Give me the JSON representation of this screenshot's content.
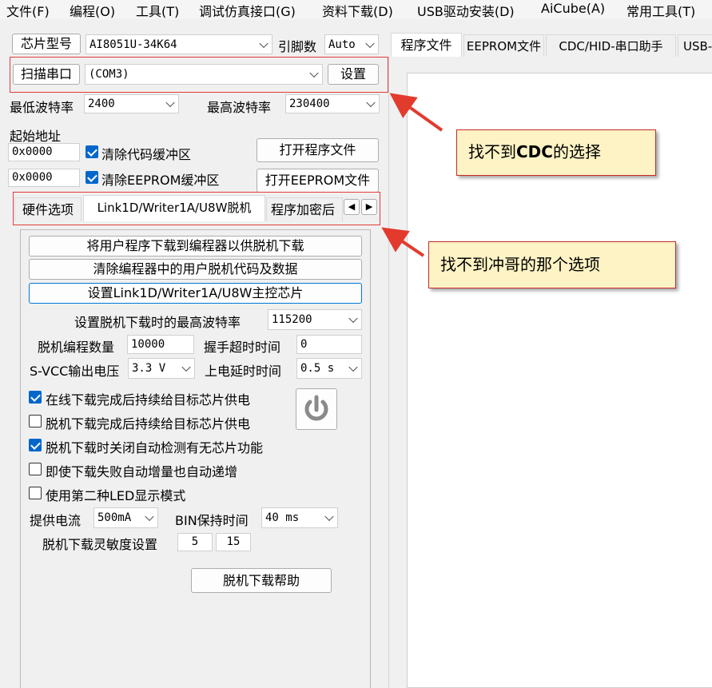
{
  "menu": [
    "文件(F)",
    "编程(O)",
    "工具(T)",
    "调试仿真接口(G)",
    "资料下载(D)",
    "USB驱动安装(D)",
    "AiCube(A)",
    "常用工具(T)"
  ],
  "chip": {
    "label": "芯片型号",
    "value": "AI8051U-34K64",
    "pin_label": "引脚数",
    "pin_value": "Auto"
  },
  "port": {
    "scan_label": "扫描串口",
    "value": "(COM3)",
    "settings_label": "设置"
  },
  "baud": {
    "min_label": "最低波特率",
    "min_value": "2400",
    "max_label": "最高波特率",
    "max_value": "230400"
  },
  "address": {
    "start_label": "起始地址",
    "code_addr": "0x0000",
    "clear_code_label": "清除代码缓冲区",
    "eeprom_addr": "0x0000",
    "clear_eeprom_label": "清除EEPROM缓冲区",
    "open_program": "打开程序文件",
    "open_eeprom": "打开EEPROM文件"
  },
  "left_tabs": [
    "硬件选项",
    "Link1D/Writer1A/U8W脱机",
    "程序加密后"
  ],
  "right_tabs": [
    "程序文件",
    "EEPROM文件",
    "CDC/HID-串口助手",
    "USB-"
  ],
  "offline": {
    "btn_download": "将用户程序下载到编程器以供脱机下载",
    "btn_clear": "清除编程器中的用户脱机代码及数据",
    "btn_set_main": "设置Link1D/Writer1A/U8W主控芯片",
    "max_baud_label": "设置脱机下载时的最高波特率",
    "max_baud_value": "115200",
    "count_label": "脱机编程数量",
    "count_value": "10000",
    "handshake_label": "握手超时时间",
    "handshake_value": "0",
    "svcc_label": "S-VCC输出电压",
    "svcc_value": "3.3 V",
    "delay_label": "上电延时时间",
    "delay_value": "0.5 s",
    "cb1": "在线下载完成后持续给目标芯片供电",
    "cb2": "脱机下载完成后持续给目标芯片供电",
    "cb3": "脱机下载时关闭自动检测有无芯片功能",
    "cb4": "即使下载失败自动增量也自动递增",
    "cb5": "使用第二种LED显示模式",
    "current_label": "提供电流",
    "current_value": "500mA",
    "bin_label": "BIN保持时间",
    "bin_value": "40 ms",
    "sens_label": "脱机下载灵敏度设置",
    "sens_a": "5",
    "sens_b": "15",
    "help_label": "脱机下载帮助"
  },
  "annotations": {
    "callout1_pre": "找不到",
    "callout1_bold": "CDC",
    "callout1_post": "的选择",
    "callout2": "找不到冲哥的那个选项"
  },
  "colors": {
    "accent": "#0078d7",
    "annotation_red": "#e43a3a",
    "callout_bg": "#fdf3c4"
  }
}
